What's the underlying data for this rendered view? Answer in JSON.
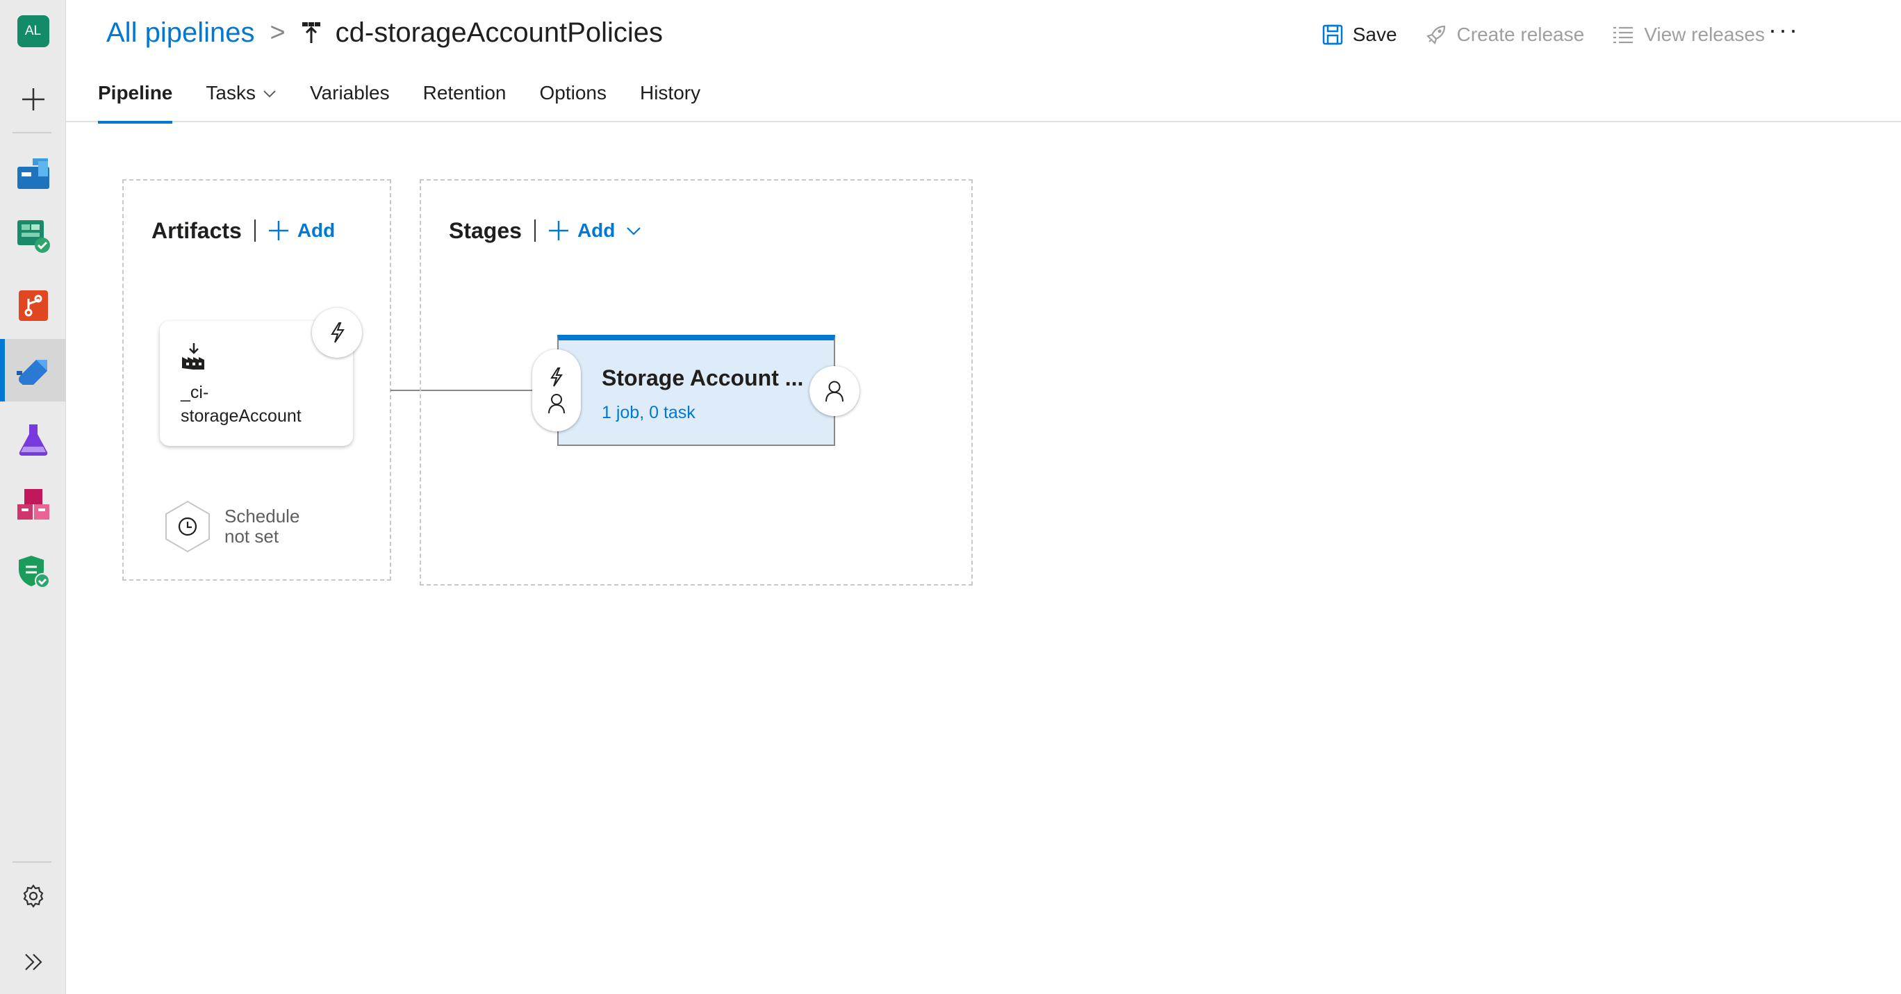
{
  "rail": {
    "avatar_initials": "AL",
    "items": [
      {
        "name": "new-item-icon"
      },
      {
        "name": "boards-icon"
      },
      {
        "name": "test-plans-check-icon"
      },
      {
        "name": "repos-icon"
      },
      {
        "name": "pipelines-icon"
      },
      {
        "name": "test-plans-icon"
      },
      {
        "name": "artifacts-icon"
      },
      {
        "name": "security-shield-icon"
      }
    ],
    "settings_icon": "gear-icon",
    "expand_icon": "double-chevron-right-icon"
  },
  "header": {
    "breadcrumb_root": "All pipelines",
    "breadcrumb_separator": ">",
    "pipeline_title": "cd-storageAccountPolicies",
    "actions": {
      "save": "Save",
      "create_release": "Create release",
      "view_releases": "View releases",
      "more": "···"
    },
    "tabs": [
      "Pipeline",
      "Tasks",
      "Variables",
      "Retention",
      "Options",
      "History"
    ],
    "active_tab": "Pipeline"
  },
  "artifacts": {
    "title": "Artifacts",
    "add_label": "Add",
    "artifact_name_line1": "_ci-",
    "artifact_name_line2": "storageAccount",
    "schedule_line1": "Schedule",
    "schedule_line2": "not set"
  },
  "stages": {
    "title": "Stages",
    "add_label": "Add",
    "stage_name": "Storage Account ...",
    "stage_summary": "1 job, 0 task"
  },
  "colors": {
    "accent": "#0078d4",
    "stage_fill": "#deecf9",
    "avatar": "#138a68"
  }
}
